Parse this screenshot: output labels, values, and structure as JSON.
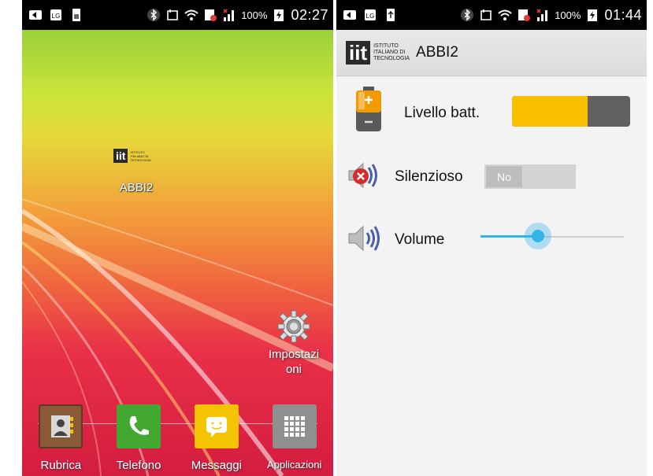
{
  "left_screen": {
    "statusbar": {
      "battery_pct": "100%",
      "time": "02:27"
    },
    "home_icon": {
      "label": "ABBI2"
    },
    "settings_shortcut": {
      "label_line1": "Impostazi",
      "label_line2": "oni"
    },
    "dock": [
      {
        "label": "Rubrica",
        "icon": "contacts-icon"
      },
      {
        "label": "Telefono",
        "icon": "phone-icon"
      },
      {
        "label": "Messaggi",
        "icon": "messages-icon"
      },
      {
        "label": "Applicazioni",
        "icon": "apps-grid-icon"
      }
    ]
  },
  "right_screen": {
    "statusbar": {
      "battery_pct": "100%",
      "time": "01:44"
    },
    "actionbar": {
      "logo_text": "iit",
      "logo_line1": "ISTITUTO",
      "logo_line2": "ITALIANO DI",
      "logo_line3": "TECNOLOGIA",
      "title": "ABBI2"
    },
    "battery_level": {
      "label": "Livello batt.",
      "level_fraction": 0.64
    },
    "silent": {
      "label": "Silenzioso",
      "value": "No"
    },
    "volume": {
      "label": "Volume",
      "level_fraction": 0.4
    },
    "colors": {
      "accent": "#33b5e5",
      "battery_fill": "#fbbf00",
      "battery_empty": "#616161"
    }
  }
}
